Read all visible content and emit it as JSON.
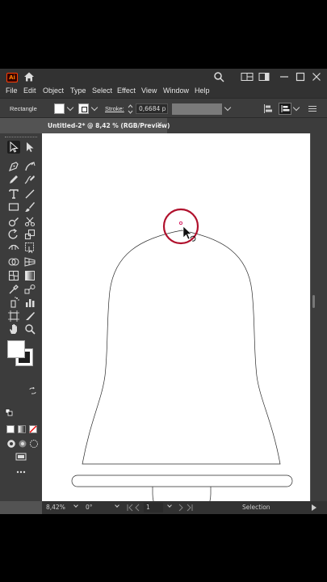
{
  "app": {
    "logo": "Ai",
    "accent": "#ff7c00"
  },
  "menu": [
    "File",
    "Edit",
    "Object",
    "Type",
    "Select",
    "Effect",
    "View",
    "Window",
    "Help"
  ],
  "control_bar": {
    "selection_type": "Rectangle",
    "stroke_label": "Stroke:",
    "stroke_value": "0,6684 p"
  },
  "document": {
    "tab_title": "Untitled-2* @ 8,42 % (RGB/Preview)",
    "close_glyph": "✕"
  },
  "status_bar": {
    "zoom": "8,42%",
    "rotation": "0°",
    "artboard_number": "1",
    "tool_name": "Selection"
  },
  "colors": {
    "selection_highlight": "#b0102c",
    "anchor": "#d4145a",
    "panel_dark": "#323232",
    "panel_mid": "#3c3c3c",
    "pasteboard": "#535353"
  },
  "icons": [
    "home-icon",
    "search-icon",
    "arrange-documents-icon",
    "workspace-icon",
    "minimize-icon",
    "maximize-icon",
    "close-icon"
  ]
}
